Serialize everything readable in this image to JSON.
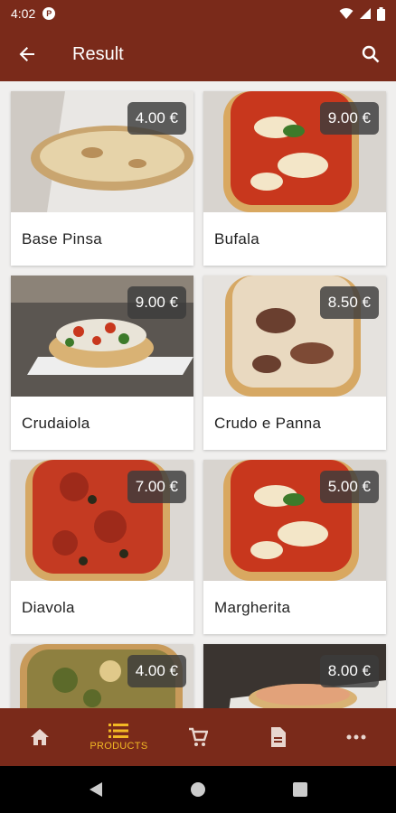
{
  "status_bar": {
    "time": "4:02",
    "app_badge": "P"
  },
  "app_bar": {
    "title": "Result"
  },
  "products": [
    {
      "name": "Base Pinsa",
      "price": "4.00 €"
    },
    {
      "name": "Bufala",
      "price": "9.00 €"
    },
    {
      "name": "Crudaiola",
      "price": "9.00 €"
    },
    {
      "name": "Crudo e Panna",
      "price": "8.50 €"
    },
    {
      "name": "Diavola",
      "price": "7.00 €"
    },
    {
      "name": "Margherita",
      "price": "5.00 €"
    },
    {
      "name": "",
      "price": "4.00 €"
    },
    {
      "name": "",
      "price": "8.00 €"
    }
  ],
  "bottom_nav": {
    "items": [
      {
        "icon": "home-icon",
        "label": ""
      },
      {
        "icon": "list-icon",
        "label": "PRODUCTS"
      },
      {
        "icon": "cart-icon",
        "label": ""
      },
      {
        "icon": "document-icon",
        "label": ""
      },
      {
        "icon": "more-icon",
        "label": ""
      }
    ],
    "active_index": 1
  },
  "colors": {
    "primary": "#7a2a1a",
    "accent": "#f2b824",
    "price_tag_bg": "#3c3c3c"
  }
}
